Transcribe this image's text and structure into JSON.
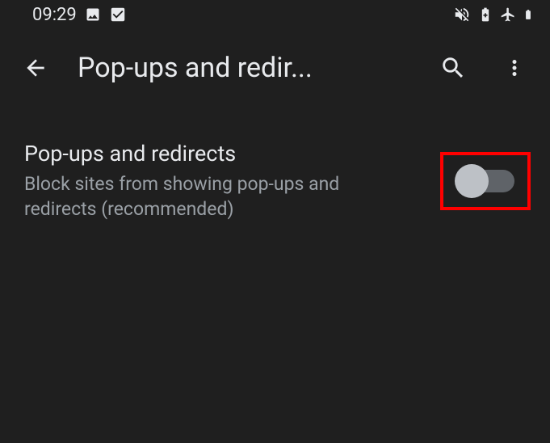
{
  "status_bar": {
    "time": "09:29"
  },
  "app_bar": {
    "title": "Pop-ups and redir..."
  },
  "setting": {
    "title": "Pop-ups and redirects",
    "subtitle": "Block sites from showing pop-ups and redirects (recommended)",
    "enabled": false
  }
}
